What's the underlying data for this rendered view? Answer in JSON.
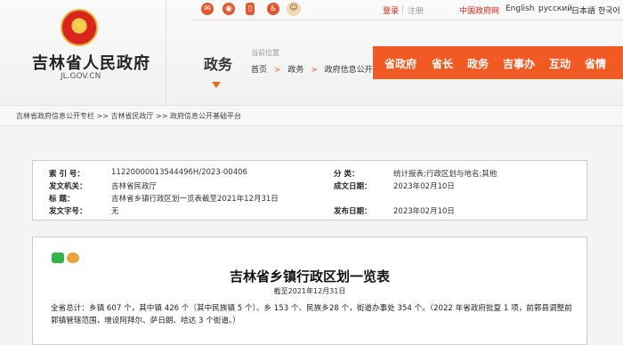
{
  "site": {
    "name": "吉林省人民政府",
    "domain": "JL.GOV.CN"
  },
  "topbar": {
    "icons": [
      "wechat-icon",
      "weibo-icon",
      "mobile-icon",
      "accessibility-icon",
      "mascot-icon"
    ],
    "login": "登录",
    "register": "注册",
    "china_gov": "中国政府网",
    "lang_en": "English",
    "lang_ru": "русский",
    "lang_ja": "日本語",
    "lang_ko": "한국어"
  },
  "section": {
    "title": "政务",
    "location_label": "当前位置",
    "crumbs": [
      "首页",
      "政务",
      "政府信息公开"
    ],
    "crumb_sep": ">"
  },
  "main_nav": [
    "省政府",
    "省长",
    "政务",
    "吉事办",
    "互动",
    "省情"
  ],
  "breadcrumb": "吉林省政府信息公开专栏 >> 吉林省民政厅 >> 政府信息公开基础平台",
  "meta": {
    "index_label": "索 引 号：",
    "index_value": "11220000013544496H/2023-00406",
    "category_label": "分 类：",
    "category_value": "统计报表;行政区划与地名;其他",
    "issuer_label": "发文机关：",
    "issuer_value": "吉林省民政厅",
    "date_label": "成文日期：",
    "date_value": "2023年02月10日",
    "title_label": "标 题：",
    "title_value": "吉林省乡镇行政区划一览表截至2021年12月31日",
    "doc_no_label": "发文字号：",
    "doc_no_value": "无",
    "publish_label": "发布日期：",
    "publish_value": "2023年02月10日"
  },
  "article": {
    "title": "吉林省乡镇行政区划一览表",
    "date": "截至2021年12月31日",
    "paragraph": "全省总计：乡镇 607 个，其中镇 426 个（其中民族镇 5 个）、乡 153 个、民族乡28 个，街道办事处 354 个。（2022 年省政府批复 1 项，前郭县调整前郭镇管辖范围，增设阿拜尔、萨日朗、哈达 3 个街道。）"
  },
  "colors": {
    "accent": "#f15a22",
    "red": "#d9261c"
  }
}
